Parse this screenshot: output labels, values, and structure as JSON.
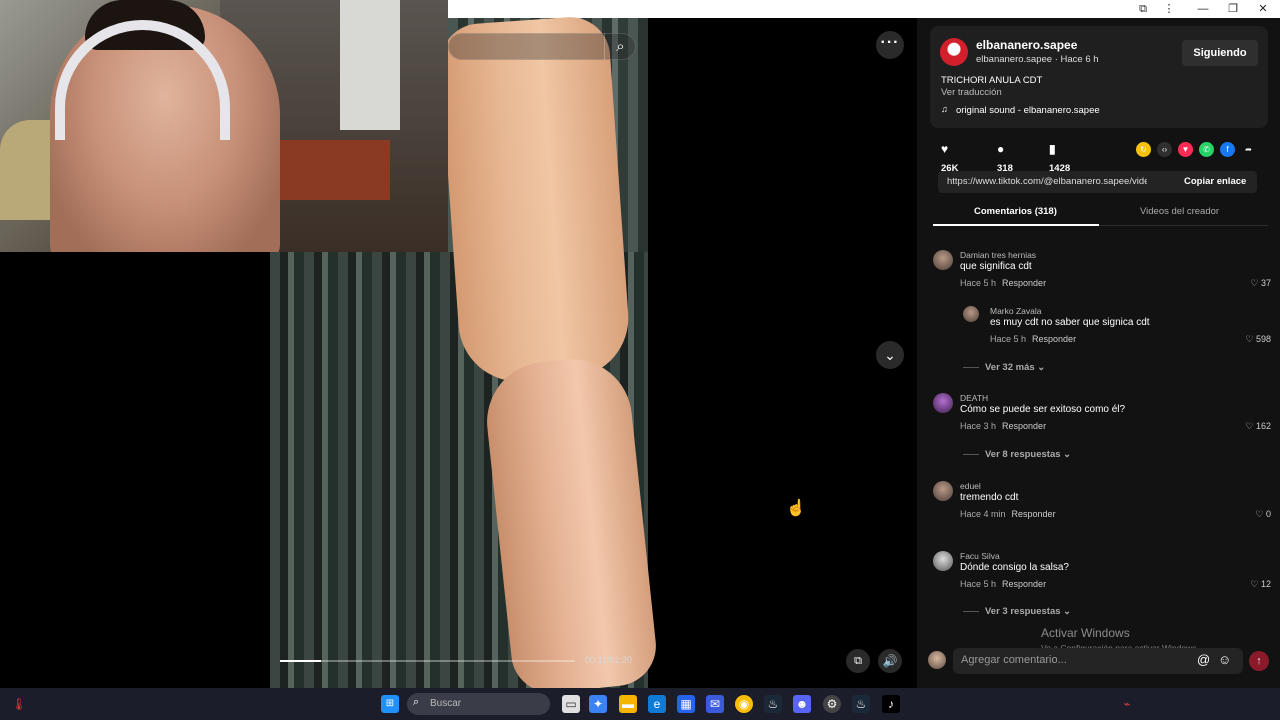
{
  "titlebar": {
    "ext_icon": "puzzle-icon",
    "menu_icon": "kebab-icon",
    "minimize": "—",
    "restore": "❐",
    "close": "✕"
  },
  "video": {
    "search_icon": "search-icon",
    "more_icon": "more-dots-icon",
    "next_icon": "chevron-down-icon",
    "time": "00:11/01:20",
    "progress": 0.14,
    "pip_icon": "picture-in-picture-icon",
    "volume_icon": "volume-icon"
  },
  "author": {
    "name": "elbananero.sapee",
    "sub": "elbananero.sapee · Hace 6 h",
    "follow_label": "Siguiendo",
    "description": "TRICHORI ANULA CDT",
    "translate": "Ver traducción",
    "sound": "original sound - elbananero.sapee"
  },
  "stats": {
    "likes": "26K",
    "comments": "318",
    "saves": "1428"
  },
  "share_colors": [
    "#f4c20d",
    "#2f2f2f",
    "#fe2c55",
    "#25d366",
    "#1877f2",
    "#121212"
  ],
  "link": {
    "url": "https://www.tiktok.com/@elbananero.sapee/video...",
    "copy_label": "Copiar enlace"
  },
  "tabs": [
    {
      "label": "Comentarios (318)"
    },
    {
      "label": "Videos del creador"
    }
  ],
  "comments": [
    {
      "user": "Damian tres hernias",
      "text": "que significa cdt",
      "time": "Hace 5 h",
      "reply": "Responder",
      "likes": "37"
    },
    {
      "user": "Marko Zavala",
      "text": "es muy cdt no saber que signica cdt",
      "time": "Hace 5 h",
      "reply": "Responder",
      "likes": "598"
    },
    {
      "user": "DEATH",
      "text": "Cómo se puede ser exitoso como él?",
      "time": "Hace 3 h",
      "reply": "Responder",
      "likes": "162"
    },
    {
      "user": "eduel",
      "text": "tremendo cdt",
      "time": "Hace 4 min",
      "reply": "Responder",
      "likes": "0"
    },
    {
      "user": "Facu Silva",
      "text": "Dónde consigo la salsa?",
      "time": "Hace 5 h",
      "reply": "Responder",
      "likes": "12"
    }
  ],
  "more_replies": [
    "Ver 32 más",
    "Ver 8 respuestas",
    "Ver 3 respuestas"
  ],
  "activate": {
    "title": "Activar Windows",
    "sub": "Ve a Configuración para activar Windows."
  },
  "composer": {
    "placeholder": "Agregar comentario..."
  },
  "taskbar": {
    "search_placeholder": "Buscar"
  }
}
